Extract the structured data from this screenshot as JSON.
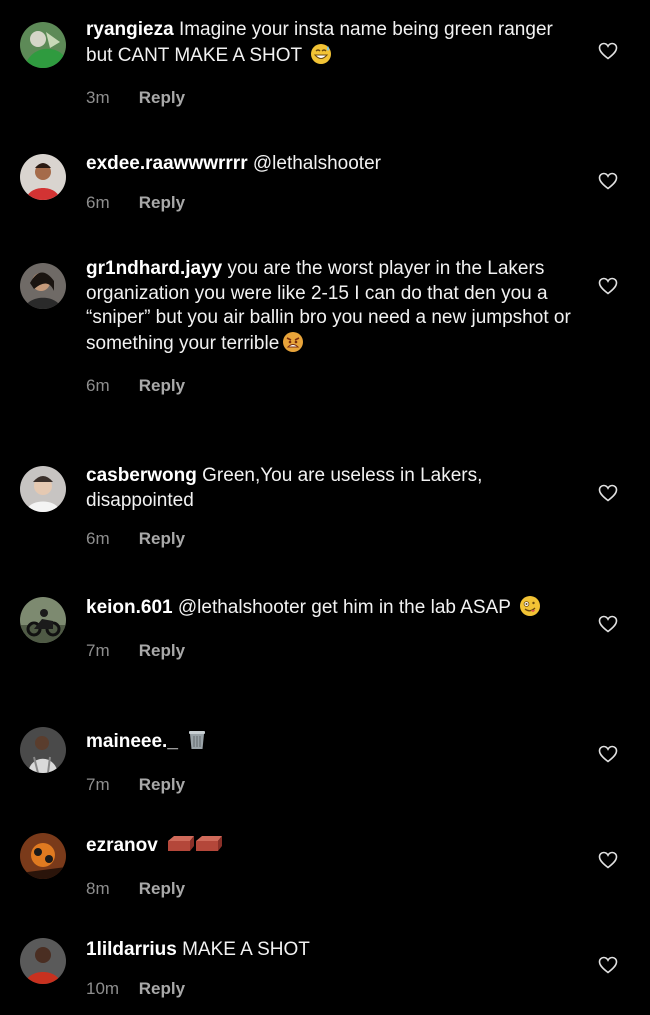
{
  "comments": [
    {
      "username": "ryangieza",
      "text": "Imagine your insta name being green ranger but CANT MAKE A SHOT",
      "emoji": "grin-sweat-emoji",
      "time": "3m",
      "reply": "Reply"
    },
    {
      "username": "exdee.raawwwrrrr",
      "text": "@lethalshooter",
      "time": "6m",
      "reply": "Reply"
    },
    {
      "username": "gr1ndhard.jayy",
      "text": "you are the worst player in the Lakers organization you were like 2-15 I can do that den you a “sniper” but you air ballin bro you need a new jumpshot or something your terrible",
      "emoji": "angry-emoji",
      "time": "6m",
      "reply": "Reply"
    },
    {
      "username": "casberwong",
      "text": "Green,You are useless in Lakers, disappointed",
      "time": "6m",
      "reply": "Reply"
    },
    {
      "username": "keion.601",
      "text": "@lethalshooter get him in the lab ASAP",
      "emoji": "zany-emoji",
      "time": "7m",
      "reply": "Reply"
    },
    {
      "username": "maineee._",
      "text": "",
      "emoji": "trash-can-emoji",
      "time": "7m",
      "reply": "Reply"
    },
    {
      "username": "ezranov",
      "text": "",
      "emoji": "brick-emoji",
      "time": "8m",
      "reply": "Reply"
    },
    {
      "username": "1lildarrius",
      "text": "MAKE A SHOT",
      "time": "10m",
      "reply": "Reply"
    }
  ],
  "colors": {
    "background": "#000000",
    "text": "#f2f2f2",
    "meta": "#8e8e8e",
    "reply": "#a8a8a8"
  }
}
